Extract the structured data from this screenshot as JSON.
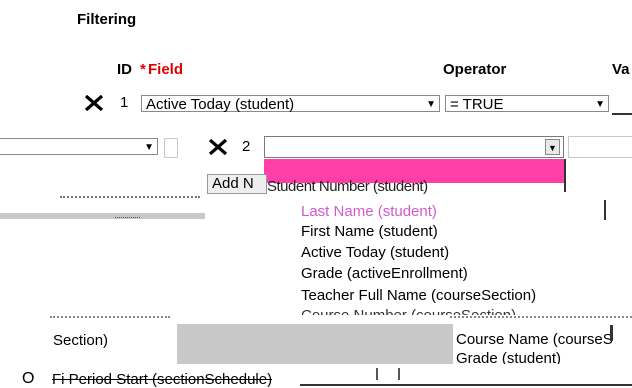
{
  "section_title": "Filtering",
  "columns": {
    "id": "ID",
    "required_marker": "*",
    "field": "Field",
    "operator": "Operator",
    "value_partial": "Va"
  },
  "row1": {
    "number": "1",
    "field_value": "Active Today (student)",
    "operator_value": "= TRUE"
  },
  "row2": {
    "number": "2",
    "field_value": ""
  },
  "add_button_partial": "Add N",
  "overlap_text": "Student Number (student)",
  "dropdown_options": [
    "Last Name (student)",
    "First Name (student)",
    "Active Today (student)",
    "Grade (activeEnrollment)",
    "Teacher Full Name (courseSection)",
    "Course Number (courseSection)"
  ],
  "left_fragment": "Section)",
  "right_option_1": "Course Name (courseS",
  "right_option_2": "Grade (student)",
  "bottom_radio_label": "O",
  "bottom_text": "Fi Period Start (sectionSchedule)",
  "colors": {
    "highlight": "#ff3fa8",
    "required": "#e00000",
    "selected_option": "#d05bd0"
  },
  "icons": [
    "delete-x-icon",
    "dropdown-arrow-icon"
  ]
}
